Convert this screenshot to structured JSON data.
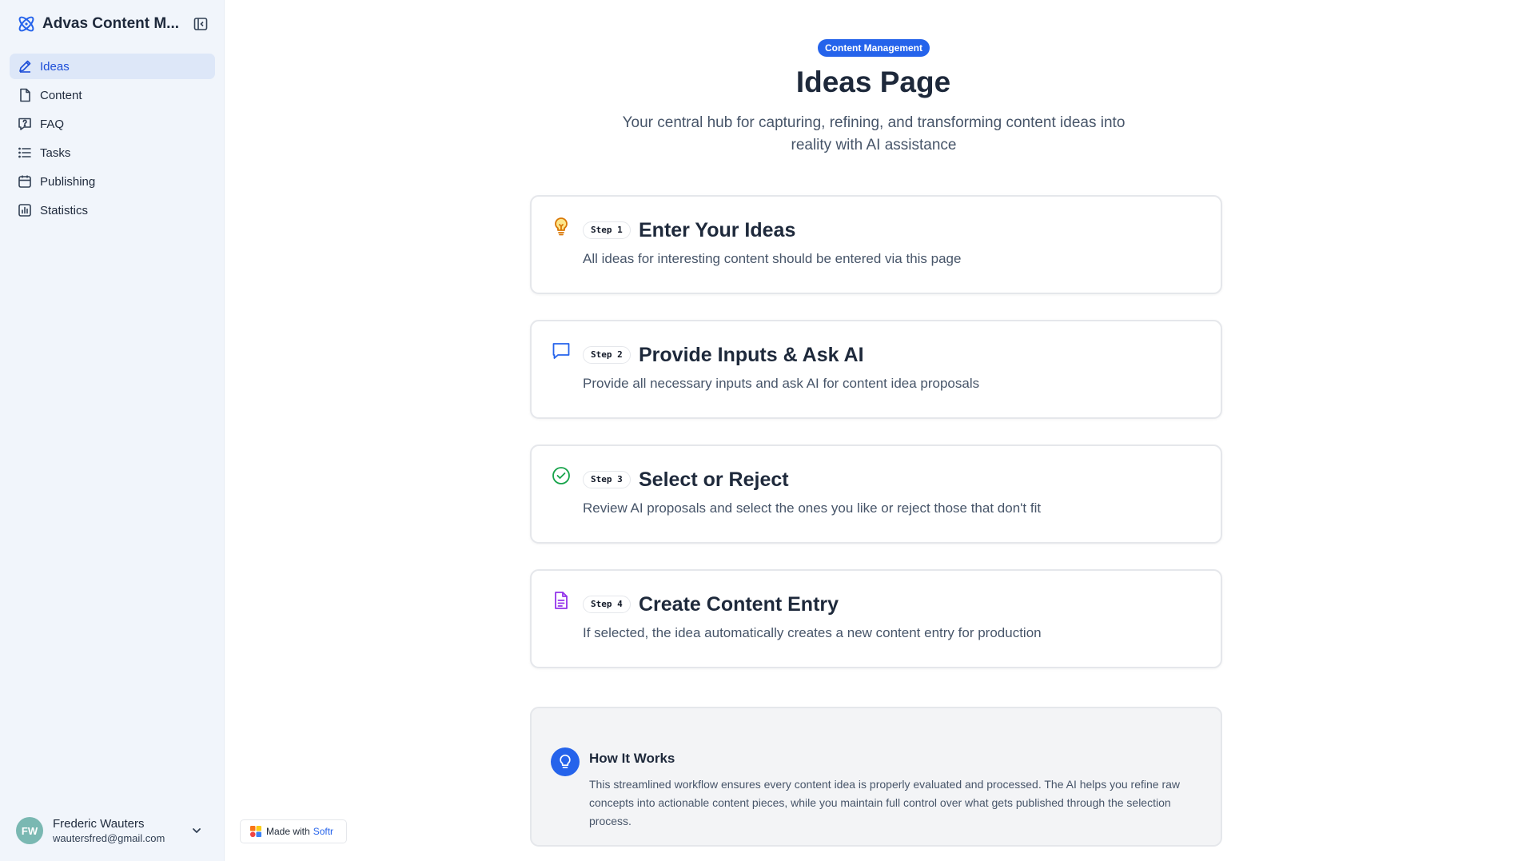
{
  "app": {
    "title": "Advas Content M...",
    "brand_color": "#2563eb"
  },
  "sidebar": {
    "items": [
      {
        "label": "Ideas",
        "icon": "pencil-icon",
        "active": true
      },
      {
        "label": "Content",
        "icon": "file-icon",
        "active": false
      },
      {
        "label": "FAQ",
        "icon": "message-question-icon",
        "active": false
      },
      {
        "label": "Tasks",
        "icon": "list-icon",
        "active": false
      },
      {
        "label": "Publishing",
        "icon": "calendar-icon",
        "active": false
      },
      {
        "label": "Statistics",
        "icon": "bar-chart-icon",
        "active": false
      }
    ],
    "user": {
      "initials": "FW",
      "name": "Frederic Wauters",
      "email": "wautersfred@gmail.com"
    }
  },
  "badge": {
    "prefix": "Made with",
    "brand": "Softr"
  },
  "header": {
    "tag": "Content Management",
    "title": "Ideas Page",
    "subtitle": "Your central hub for capturing, refining, and transforming content ideas into reality with AI assistance"
  },
  "steps": [
    {
      "badge": "Step 1",
      "title": "Enter Your Ideas",
      "description": "All ideas for interesting content should be entered via this page",
      "icon": "lightbulb-icon",
      "icon_color": "#d97706"
    },
    {
      "badge": "Step 2",
      "title": "Provide Inputs & Ask AI",
      "description": "Provide all necessary inputs and ask AI for content idea proposals",
      "icon": "chat-bubble-icon",
      "icon_color": "#2563eb"
    },
    {
      "badge": "Step 3",
      "title": "Select or Reject",
      "description": "Review AI proposals and select the ones you like or reject those that don't fit",
      "icon": "check-circle-icon",
      "icon_color": "#16a34a"
    },
    {
      "badge": "Step 4",
      "title": "Create Content Entry",
      "description": "If selected, the idea automatically creates a new content entry for production",
      "icon": "document-icon",
      "icon_color": "#9333ea"
    }
  ],
  "info": {
    "title": "How It Works",
    "text": "This streamlined workflow ensures every content idea is properly evaluated and processed. The AI helps you refine raw concepts into actionable content pieces, while you maintain full control over what gets published through the selection process.",
    "icon": "lightbulb-icon"
  }
}
